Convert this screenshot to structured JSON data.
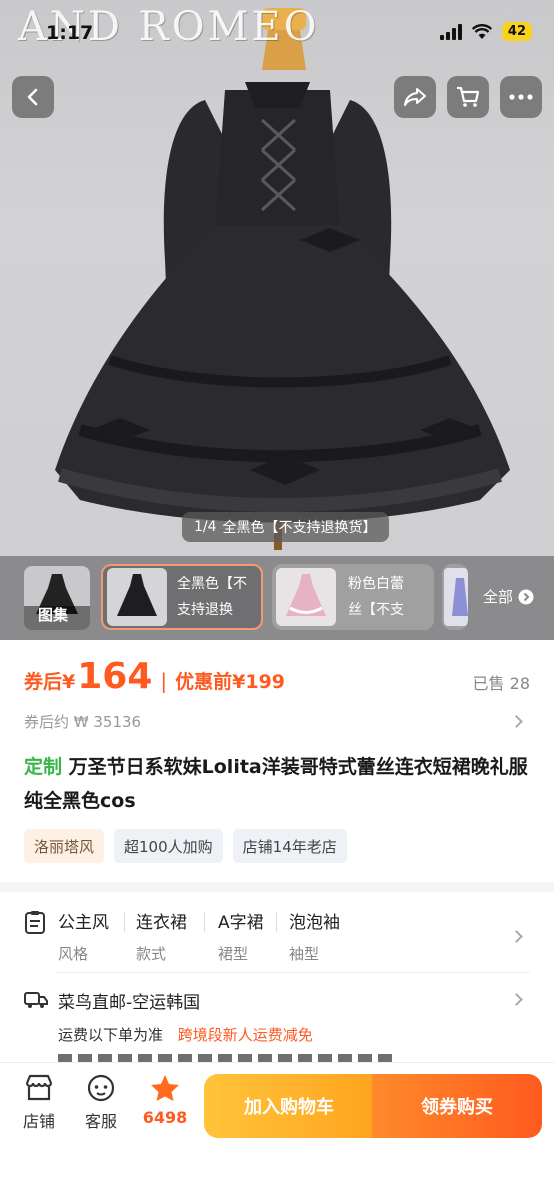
{
  "status_bar": {
    "time": "1:17",
    "battery": "42"
  },
  "hero": {
    "watermark": "AND ROMEO",
    "counter": "1/4",
    "variant_label": "全黑色【不支持退换货】"
  },
  "variants": {
    "gallery_label": "图集",
    "items": [
      {
        "label_line1": "全黑色【不",
        "label_line2": "支持退换"
      },
      {
        "label_line1": "粉色白蕾",
        "label_line2": "丝【不支"
      }
    ],
    "all_label": "全部"
  },
  "price": {
    "after_coupon_label": "券后¥",
    "after_coupon_value": "164",
    "separator": "|",
    "before_label": "优惠前¥199",
    "sold": "已售 28",
    "approx": "券后约 ₩ 35136"
  },
  "product": {
    "tag": "定制",
    "title": "万圣节日系软妹Lolita洋装哥特式蕾丝连衣短裙晚礼服纯全黑色cos"
  },
  "chips": [
    "洛丽塔风",
    "超100人加购",
    "店铺14年老店"
  ],
  "attributes": [
    {
      "value": "公主风",
      "key": "风格"
    },
    {
      "value": "连衣裙",
      "key": "款式"
    },
    {
      "value": "A字裙",
      "key": "裙型"
    },
    {
      "value": "泡泡袖",
      "key": "袖型"
    }
  ],
  "shipping": {
    "title": "菜鸟直邮-空运韩国",
    "subtitle": "运费以下单为准",
    "highlight": "跨境段新人运费减免"
  },
  "bottom_bar": {
    "store": "店铺",
    "service": "客服",
    "favorites": "6498",
    "add_to_cart": "加入购物车",
    "buy": "领券购买"
  },
  "colors": {
    "accent": "#ff5a1f",
    "tag_green": "#3ab54a",
    "cart_yellow": "#ffb22a"
  }
}
